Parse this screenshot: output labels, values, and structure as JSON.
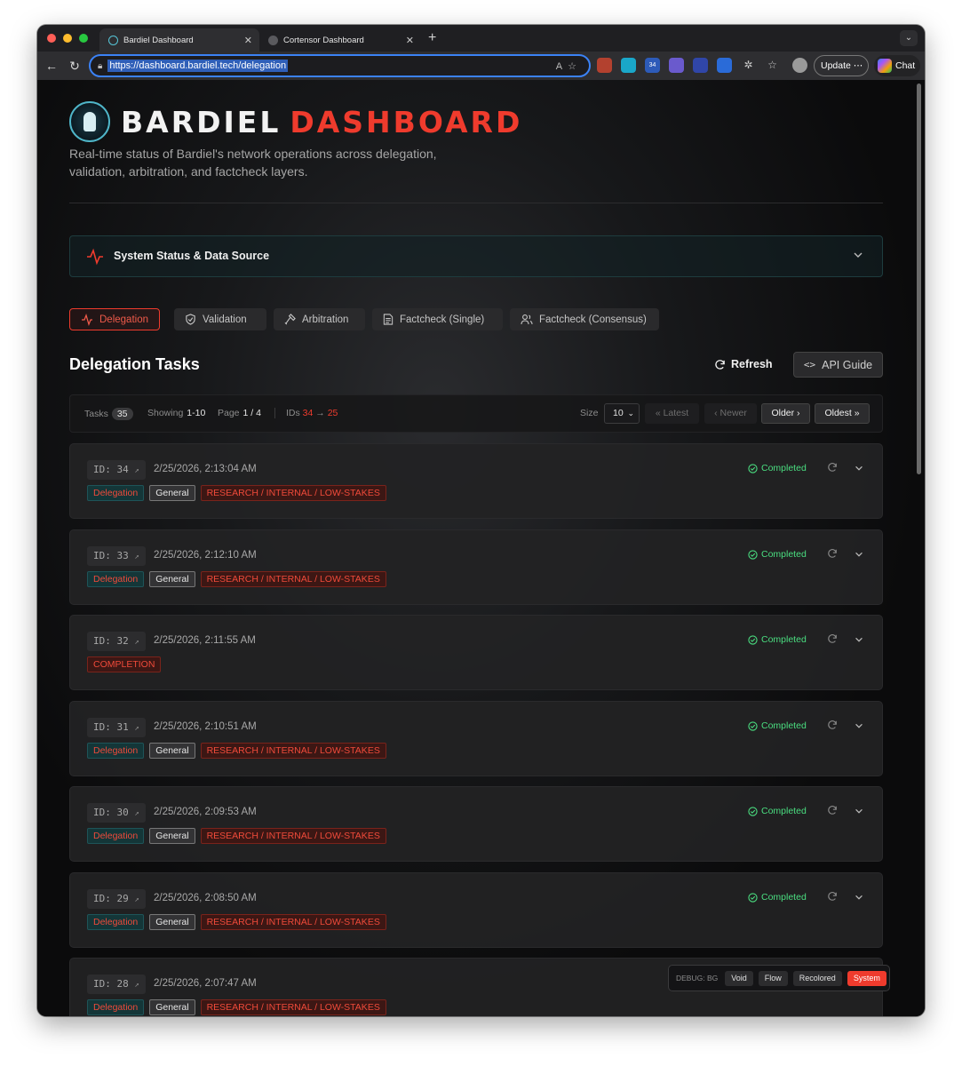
{
  "browser": {
    "tabs": [
      {
        "title": "Bardiel Dashboard",
        "active": true
      },
      {
        "title": "Cortensor Dashboard",
        "active": false
      }
    ],
    "url": "https://dashboard.bardiel.tech/delegation",
    "update_label": "Update",
    "chat_label": "Chat",
    "ext_badge": "34"
  },
  "header": {
    "title_part1": "BARDIEL",
    "title_part2": "DASHBOARD",
    "subtitle": "Real-time status of Bardiel's network operations across delegation, validation, arbitration, and factcheck layers."
  },
  "system_status": {
    "label": "System Status & Data Source"
  },
  "tabs": [
    {
      "label": "Delegation",
      "icon": "activity-icon",
      "active": true
    },
    {
      "label": "Validation",
      "icon": "shield-icon",
      "active": false
    },
    {
      "label": "Arbitration",
      "icon": "gavel-icon",
      "active": false
    },
    {
      "label": "Factcheck (Single)",
      "icon": "document-icon",
      "active": false
    },
    {
      "label": "Factcheck (Consensus)",
      "icon": "users-icon",
      "active": false
    }
  ],
  "section": {
    "title": "Delegation Tasks",
    "refresh_label": "Refresh",
    "api_guide_label": "API Guide"
  },
  "stats": {
    "tasks_label": "Tasks",
    "tasks_count": "35",
    "showing_label": "Showing",
    "showing_value": "1-10",
    "page_label": "Page",
    "page_value": "1 / 4",
    "ids_label": "IDs",
    "ids_from": "34",
    "ids_arrow": "→",
    "ids_to": "25",
    "size_label": "Size",
    "size_value": "10",
    "latest_label": "« Latest",
    "newer_label": "‹ Newer",
    "older_label": "Older ›",
    "oldest_label": "Oldest »"
  },
  "tasks": [
    {
      "id_label": "ID: 34",
      "timestamp": "2/25/2026, 2:13:04 AM",
      "status": "Completed",
      "tags": [
        "Delegation",
        "General",
        "RESEARCH / INTERNAL / LOW-STAKES"
      ]
    },
    {
      "id_label": "ID: 33",
      "timestamp": "2/25/2026, 2:12:10 AM",
      "status": "Completed",
      "tags": [
        "Delegation",
        "General",
        "RESEARCH / INTERNAL / LOW-STAKES"
      ]
    },
    {
      "id_label": "ID: 32",
      "timestamp": "2/25/2026, 2:11:55 AM",
      "status": "Completed",
      "tags": [
        "COMPLETION"
      ]
    },
    {
      "id_label": "ID: 31",
      "timestamp": "2/25/2026, 2:10:51 AM",
      "status": "Completed",
      "tags": [
        "Delegation",
        "General",
        "RESEARCH / INTERNAL / LOW-STAKES"
      ]
    },
    {
      "id_label": "ID: 30",
      "timestamp": "2/25/2026, 2:09:53 AM",
      "status": "Completed",
      "tags": [
        "Delegation",
        "General",
        "RESEARCH / INTERNAL / LOW-STAKES"
      ]
    },
    {
      "id_label": "ID: 29",
      "timestamp": "2/25/2026, 2:08:50 AM",
      "status": "Completed",
      "tags": [
        "Delegation",
        "General",
        "RESEARCH / INTERNAL / LOW-STAKES"
      ]
    },
    {
      "id_label": "ID: 28",
      "timestamp": "2/25/2026, 2:07:47 AM",
      "status": "",
      "tags": [
        "Delegation",
        "General",
        "RESEARCH / INTERNAL / LOW-STAKES"
      ]
    }
  ],
  "debug": {
    "label": "DEBUG: BG",
    "options": [
      {
        "label": "Void",
        "active": false
      },
      {
        "label": "Flow",
        "active": false
      },
      {
        "label": "Recolored",
        "active": false
      },
      {
        "label": "System",
        "active": true
      }
    ]
  },
  "colors": {
    "accent_red": "#ef3b2d",
    "status_green": "#4ade80",
    "url_focus_blue": "#3b82f6"
  }
}
